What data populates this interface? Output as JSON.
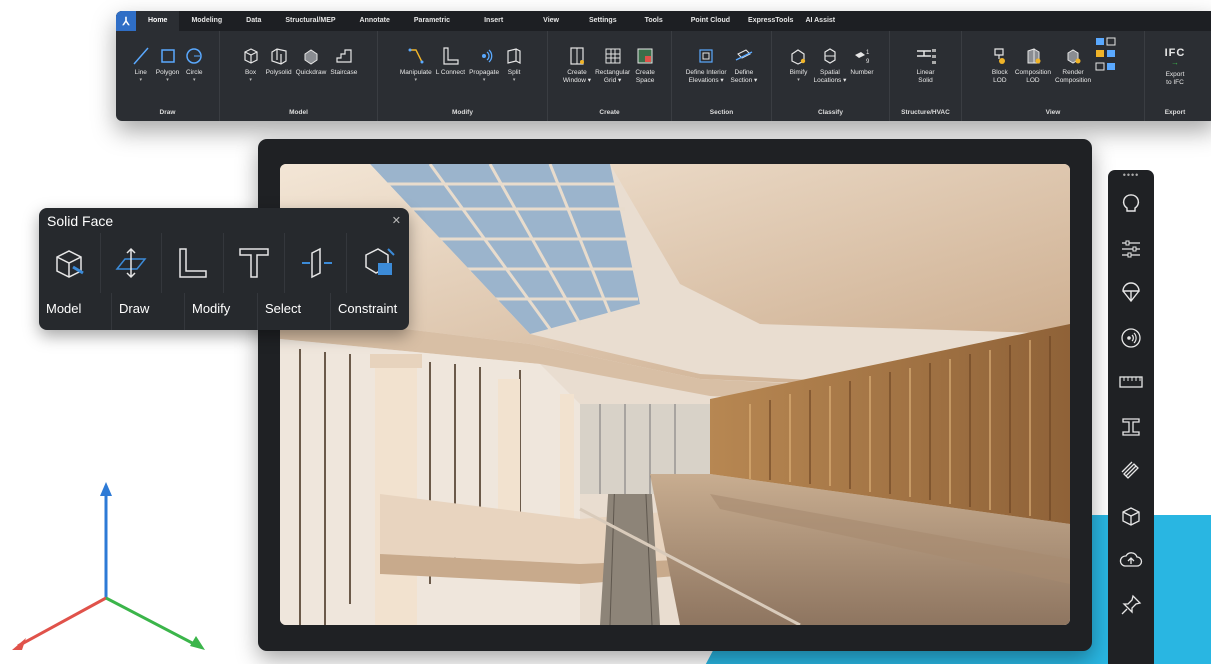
{
  "app": {
    "logo": "⅄"
  },
  "ribbon": {
    "tabs": [
      "Home",
      "Modeling",
      "Data",
      "Structural/MEP",
      "Annotate",
      "Parametric",
      "Insert",
      "View",
      "Settings",
      "Tools",
      "Point Cloud",
      "ExpressTools",
      "AI Assist"
    ],
    "active_tab": "Home",
    "panels": {
      "draw": {
        "title": "Draw",
        "tools": [
          "Line",
          "Polygon",
          "Circle"
        ]
      },
      "model": {
        "title": "Model",
        "tools": [
          "Box",
          "Polysolid",
          "Quickdraw",
          "Staircase"
        ]
      },
      "modify": {
        "title": "Modify",
        "tools": [
          "Manipulate",
          "L Connect",
          "Propagate",
          "Split"
        ]
      },
      "create": {
        "title": "Create",
        "tools": [
          "Create\nWindow ▾",
          "Rectangular\nGrid ▾",
          "Create\nSpace"
        ]
      },
      "section": {
        "title": "Section",
        "tools": [
          "Define Interior\nElevations ▾",
          "Define\nSection ▾"
        ]
      },
      "classify": {
        "title": "Classify",
        "tools": [
          "Bimify",
          "Spatial\nLocations ▾",
          "Number"
        ]
      },
      "structure": {
        "title": "Structure/HVAC",
        "tools": [
          "Linear\nSolid"
        ]
      },
      "view": {
        "title": "View",
        "tools": [
          "Block\nLOD",
          "Composition\nLOD",
          "Render\nComposition"
        ]
      },
      "export": {
        "title": "Export",
        "tools": [
          "Export\nto IFC"
        ],
        "ifc_label": "IFC"
      }
    }
  },
  "solid_face": {
    "title": "Solid Face",
    "labels": [
      "Model",
      "Draw",
      "Modify",
      "Select",
      "Constraint"
    ],
    "icons": [
      "model-3d-icon",
      "plane-move-icon",
      "l-shape-icon",
      "t-shape-icon",
      "face-extrude-icon",
      "constraint-icon"
    ]
  },
  "sidebar": {
    "grip": "••••",
    "icons": [
      "lightbulb-icon",
      "sliders-icon",
      "parachute-icon",
      "propagate-icon",
      "ruler-icon",
      "i-beam-icon",
      "layers-icon",
      "cube-icon",
      "cloud-upload-icon",
      "pin-icon"
    ]
  },
  "colors": {
    "accent": "#29b6e2",
    "ribbon_bg": "#2b2e33",
    "panel_bg": "#26292d",
    "axis_x": "#e0524a",
    "axis_y": "#3bb54a",
    "axis_z": "#2d7ad6"
  }
}
